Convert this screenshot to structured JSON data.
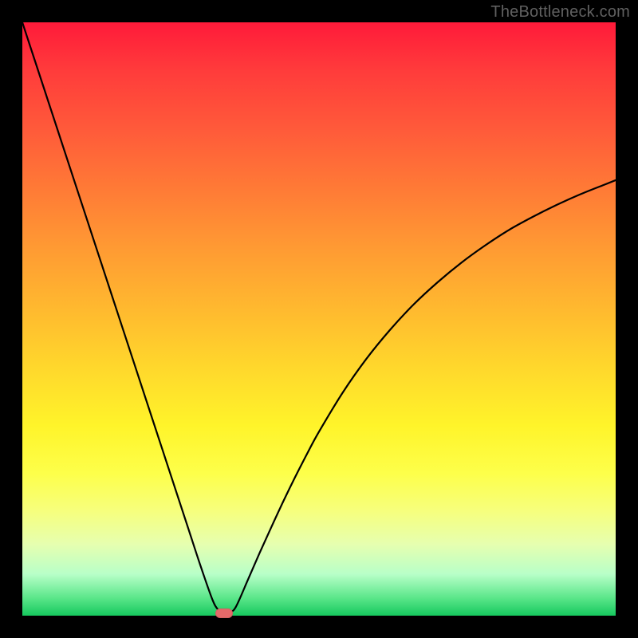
{
  "watermark": "TheBottleneck.com",
  "chart_data": {
    "type": "line",
    "title": "",
    "xlabel": "",
    "ylabel": "",
    "xlim": [
      0,
      100
    ],
    "ylim": [
      0,
      100
    ],
    "grid": false,
    "legend": false,
    "x": [
      0,
      2,
      4,
      6,
      8,
      10,
      12,
      14,
      16,
      18,
      20,
      22,
      24,
      26,
      28,
      30,
      32,
      33,
      34,
      35,
      36,
      38,
      40,
      42,
      44,
      46,
      48,
      50,
      54,
      58,
      62,
      66,
      70,
      74,
      78,
      82,
      86,
      90,
      94,
      98,
      100
    ],
    "y": [
      100,
      93.9,
      87.8,
      81.7,
      75.6,
      69.5,
      63.4,
      57.3,
      51.2,
      45.1,
      39.0,
      32.9,
      26.8,
      20.7,
      14.6,
      8.5,
      2.8,
      1.0,
      0.4,
      0.6,
      1.5,
      6.0,
      10.6,
      15.0,
      19.3,
      23.4,
      27.3,
      31.0,
      37.6,
      43.3,
      48.2,
      52.5,
      56.2,
      59.5,
      62.4,
      65.0,
      67.2,
      69.2,
      71.0,
      72.6,
      73.4
    ],
    "minimum_marker": {
      "x": 34.0,
      "y": 0.4
    },
    "background_gradient": {
      "top": "#ff1a3a",
      "bottom": "#16c95e"
    }
  }
}
